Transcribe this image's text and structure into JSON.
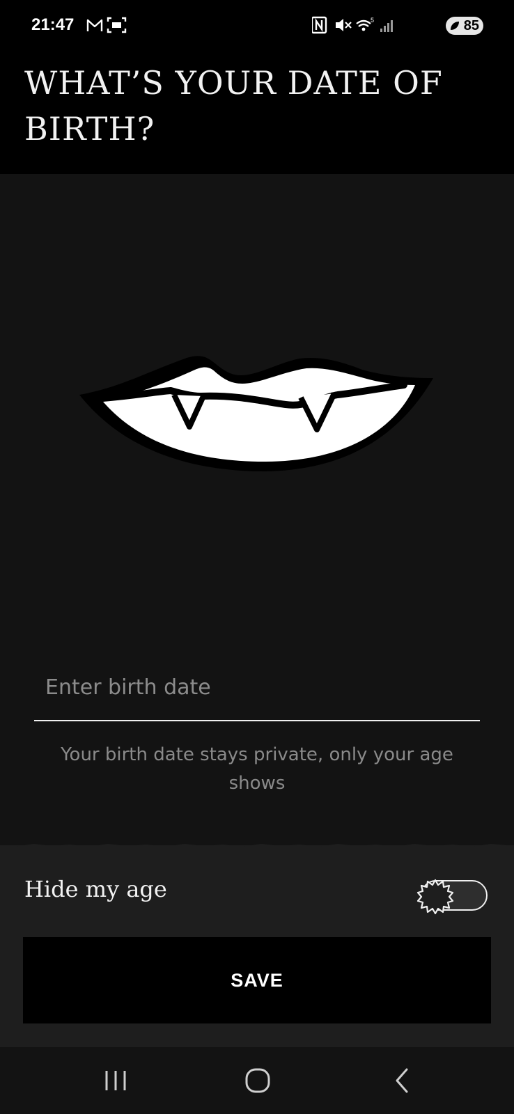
{
  "status_bar": {
    "time": "21:47",
    "battery": "85",
    "icons": [
      "gmail-icon",
      "screenshot-icon",
      "nfc-icon",
      "mute-icon",
      "wifi-icon",
      "signal-icon",
      "battery-icon"
    ]
  },
  "header": {
    "title": "WHAT’S YOUR DATE OF BIRTH?"
  },
  "illustration": {
    "icon": "vampire-lips-icon"
  },
  "birth_date": {
    "placeholder": "Enter birth date",
    "value": "",
    "helper": "Your birth date stays private, only your age shows"
  },
  "hide_age": {
    "label": "Hide my age",
    "enabled": false
  },
  "actions": {
    "save_label": "SAVE"
  },
  "nav": {
    "icons": [
      "recent-apps-icon",
      "home-icon",
      "back-icon"
    ]
  },
  "colors": {
    "header_bg": "#000000",
    "page_bg": "#131313",
    "panel_bg": "#1e1e1e",
    "text": "#f2f2f2",
    "muted_text": "#8a8a8a"
  }
}
